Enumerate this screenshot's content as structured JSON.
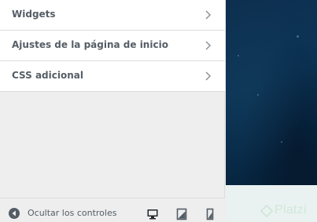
{
  "customizer": {
    "menu": [
      {
        "label": "Widgets"
      },
      {
        "label": "Ajustes de la página de inicio"
      },
      {
        "label": "CSS adicional"
      }
    ],
    "footer": {
      "collapse_label": "Ocultar los controles",
      "devices": [
        "desktop-icon",
        "tablet-icon",
        "mobile-icon"
      ]
    }
  },
  "preview": {
    "logo_text": "Platzi"
  },
  "colors": {
    "panel_bg": "#eeeeee",
    "item_bg": "#ffffff",
    "text": "#555d66",
    "preview_hero": "#0b3558",
    "logo": "#cfe8d9"
  }
}
